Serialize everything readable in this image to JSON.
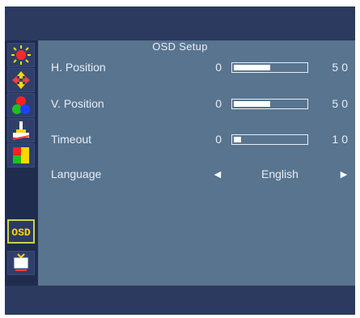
{
  "menu": {
    "title": "OSD Setup",
    "active_tab": "osd",
    "tabs": [
      {
        "name": "brightness",
        "icon": "sun-icon"
      },
      {
        "name": "position",
        "icon": "move-arrows-icon"
      },
      {
        "name": "color",
        "icon": "rgb-dots-icon"
      },
      {
        "name": "image",
        "icon": "paint-brush-icon"
      },
      {
        "name": "color-temp",
        "icon": "color-blocks-icon"
      },
      {
        "name": "osd",
        "icon": "osd-icon",
        "label": "OSD"
      },
      {
        "name": "signal",
        "icon": "tv-signal-icon"
      }
    ],
    "rows": [
      {
        "label": "H. Position",
        "min": "0",
        "max": "50",
        "level": 0.5
      },
      {
        "label": "V. Position",
        "min": "0",
        "max": "50",
        "level": 0.5
      },
      {
        "label": "Timeout",
        "min": "0",
        "max": "10",
        "level": 0.1
      }
    ],
    "language": {
      "label": "Language",
      "value": "English",
      "left_arrow": "◄",
      "right_arrow": "►"
    }
  },
  "colors": {
    "outer": "#2b3a5e",
    "panel": "#58748f",
    "icon_column": "#1f2c4d",
    "active_tab_border": "#c9d24a",
    "text": "#e9eef6"
  }
}
